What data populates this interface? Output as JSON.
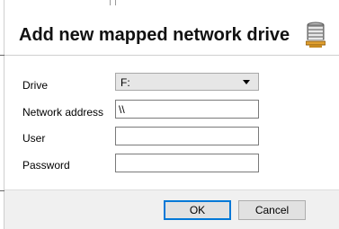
{
  "dialog": {
    "title": "Add new mapped network drive",
    "icon": "database-server-icon"
  },
  "form": {
    "drive_label": "Drive",
    "drive_value": "F:",
    "network_address_label": "Network address",
    "network_address_value": "\\\\",
    "user_label": "User",
    "user_value": "",
    "password_label": "Password",
    "password_value": ""
  },
  "buttons": {
    "ok_label": "OK",
    "cancel_label": "Cancel"
  },
  "colors": {
    "ok_border": "#0078d7",
    "footer_bg": "#f0f0f0"
  }
}
